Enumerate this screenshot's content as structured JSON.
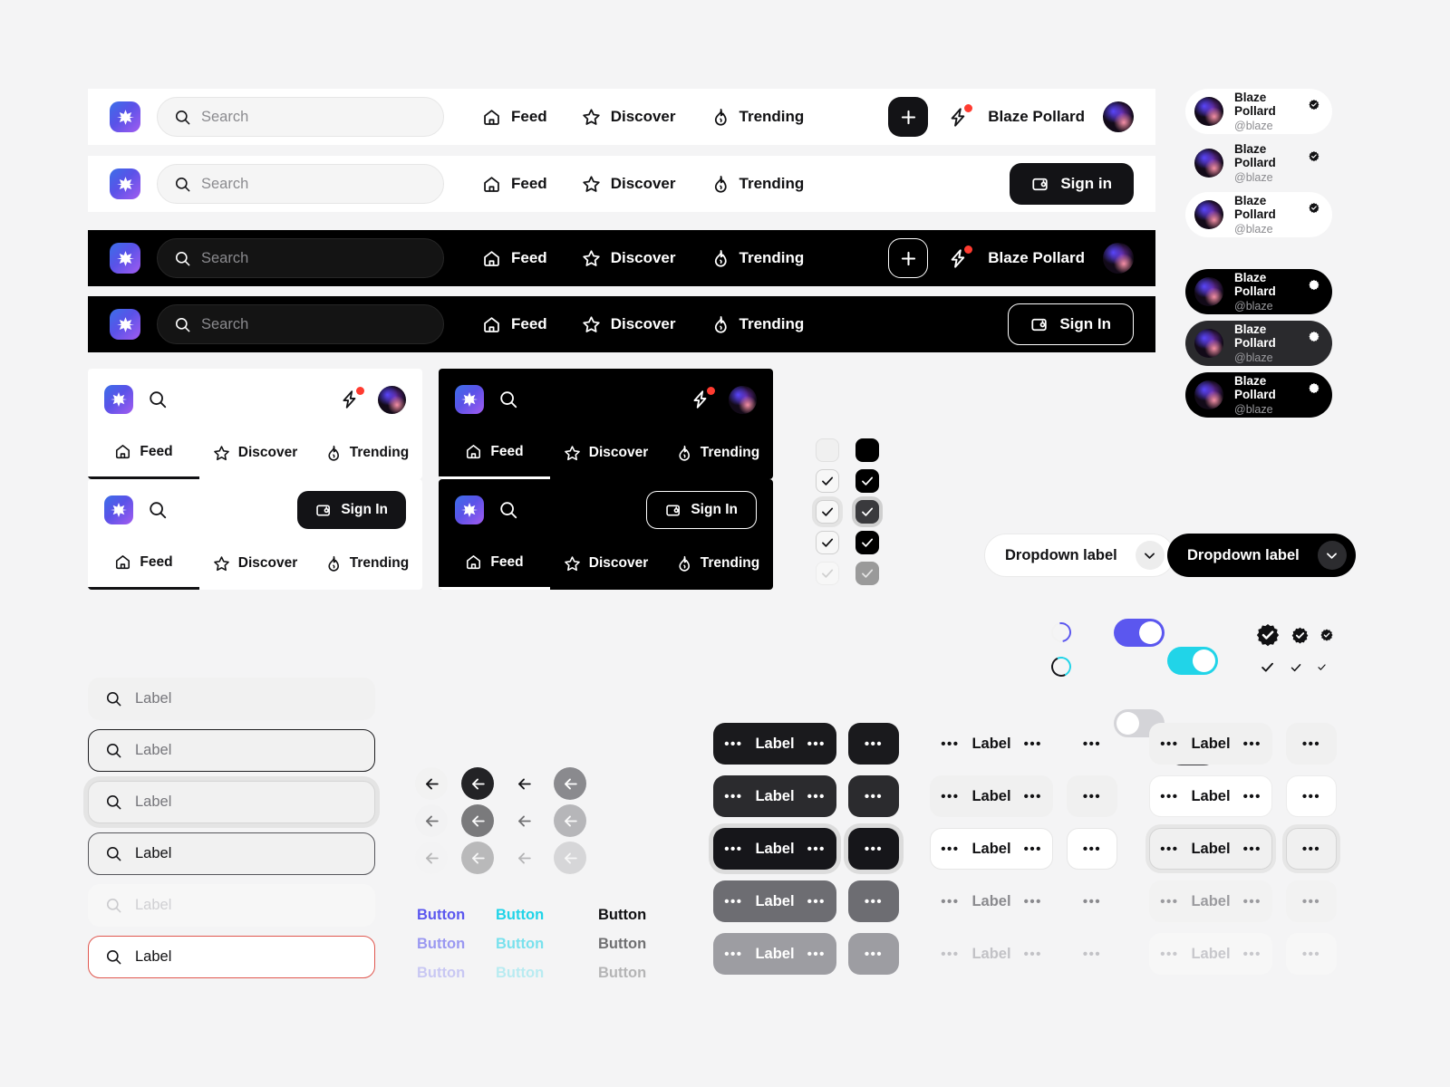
{
  "brand": {
    "logo_icon": "sparkle-star-icon",
    "gradient_from": "#3b6fe8",
    "gradient_to": "#a25cf0"
  },
  "colors": {
    "black": "#000000",
    "ink": "#111113",
    "indigo": "#5b57ef",
    "cyan": "#21d4e8",
    "danger": "#e0574f",
    "notification_dot": "#ff3b30",
    "surface": "#f4f4f5"
  },
  "search": {
    "placeholder": "Search",
    "icon": "search-icon"
  },
  "nav": {
    "items": [
      {
        "label": "Feed",
        "icon": "home-icon"
      },
      {
        "label": "Discover",
        "icon": "star-icon"
      },
      {
        "label": "Trending",
        "icon": "flame-icon"
      }
    ],
    "plus_icon": "plus-icon",
    "bolt_icon": "lightning-bolt-icon",
    "user_name": "Blaze Pollard",
    "signin_lower": "Sign in",
    "signin_upper": "Sign In",
    "signin_icon": "wallet-card-icon"
  },
  "navbars": [
    {
      "variant": "light",
      "right": "user"
    },
    {
      "variant": "light",
      "right": "signin"
    },
    {
      "variant": "dark",
      "right": "user"
    },
    {
      "variant": "dark",
      "right": "signin"
    }
  ],
  "mobile_cards": [
    {
      "theme": "light",
      "right": "user",
      "active_tab": "Feed"
    },
    {
      "theme": "dark",
      "right": "user",
      "active_tab": "Feed"
    },
    {
      "theme": "light",
      "right": "signin",
      "active_tab": "Feed"
    },
    {
      "theme": "dark",
      "right": "signin",
      "active_tab": "Feed"
    }
  ],
  "user_chips": [
    {
      "style": "l-plain",
      "name": "Blaze Pollard",
      "handle": "@blaze",
      "verified": true
    },
    {
      "style": "l-flat",
      "name": "Blaze Pollard",
      "handle": "@blaze",
      "verified": true
    },
    {
      "style": "l-plain",
      "name": "Blaze Pollard",
      "handle": "@blaze",
      "verified": true
    },
    {
      "style": "d-plain",
      "name": "Blaze Pollard",
      "handle": "@blaze",
      "verified": true
    },
    {
      "style": "d-soft",
      "name": "Blaze Pollard",
      "handle": "@blaze",
      "verified": true
    },
    {
      "style": "d-plain",
      "name": "Blaze Pollard",
      "handle": "@blaze",
      "verified": true
    }
  ],
  "checkboxes": {
    "light": [
      "light-empty",
      "light-on",
      "light-focus",
      "light-on",
      "light-dis"
    ],
    "dark": [
      "dark-empty",
      "dark-on",
      "dark-focus",
      "dark-on",
      "dark-dis"
    ],
    "checked": [
      false,
      true,
      true,
      true,
      true
    ]
  },
  "dropdowns": [
    {
      "label": "Dropdown label",
      "theme": "light",
      "icon": "chevron-down-icon"
    },
    {
      "label": "Dropdown label",
      "theme": "dark",
      "icon": "chevron-down-icon"
    }
  ],
  "toggles": [
    {
      "state": "on",
      "color": "indigo"
    },
    {
      "state": "on",
      "color": "cyan"
    },
    {
      "state": "off",
      "color": "grayon"
    },
    {
      "state": "off",
      "color": "darkon"
    }
  ],
  "spinners": [
    {
      "name": "spinner-indigo",
      "accent": "#5b57ef"
    },
    {
      "name": "spinner-cyan",
      "accent": "#21d4e8"
    }
  ],
  "verified_badges": {
    "sizes": [
      26,
      19,
      14
    ],
    "icon": "verified-badge-icon"
  },
  "check_marks": {
    "sizes": [
      17,
      14,
      11
    ],
    "icon": "check-icon"
  },
  "fields": [
    {
      "state": "f-default",
      "text": "Label",
      "icon": "search-icon"
    },
    {
      "state": "f-hover",
      "text": "Label",
      "icon": "search-icon"
    },
    {
      "state": "f-focus",
      "text": "Label",
      "icon": "search-icon"
    },
    {
      "state": "f-filled",
      "text": "Label",
      "icon": "search-icon"
    },
    {
      "state": "f-disabled",
      "text": "Label",
      "icon": "search-icon"
    },
    {
      "state": "f-error",
      "text": "Label",
      "icon": "search-icon"
    }
  ],
  "arrow_buttons": {
    "icon": "arrow-left-icon",
    "columns": [
      "soft",
      "dark",
      "bare",
      "gray"
    ],
    "rows": [
      "default",
      "muted",
      "disabled"
    ]
  },
  "text_buttons": {
    "label": "Button",
    "columns": [
      {
        "color": "#5b57ef",
        "name": "indigo"
      },
      {
        "color": "#21d4e8",
        "name": "cyan"
      },
      {
        "color": "#111113",
        "name": "black"
      }
    ],
    "rows": 3
  },
  "label_buttons": {
    "label": "Label",
    "dots": "•••",
    "columns": [
      {
        "name": "primary-solid",
        "variants": [
          "v-black",
          "v-black2",
          "v-blackring",
          "v-gray",
          "v-gray2"
        ]
      },
      {
        "name": "primary-square",
        "variants": [
          "v-black",
          "v-black2",
          "v-blackring",
          "v-gray",
          "v-gray2"
        ]
      },
      {
        "name": "ghost",
        "variants": [
          "v-ghost",
          "v-ghostfill",
          "v-ghostline",
          "v-ghostmute",
          "v-ghostmute2"
        ]
      },
      {
        "name": "ghost-square",
        "variants": [
          "v-ghost",
          "v-ghostfill",
          "v-ghostline",
          "v-ghostmute",
          "v-ghostmute2"
        ]
      },
      {
        "name": "secondary",
        "variants": [
          "v-fill",
          "v-line",
          "v-ring",
          "v-dis",
          "v-dis2"
        ]
      },
      {
        "name": "secondary-square",
        "variants": [
          "v-fill",
          "v-line",
          "v-ring",
          "v-dis",
          "v-dis2"
        ]
      }
    ]
  }
}
